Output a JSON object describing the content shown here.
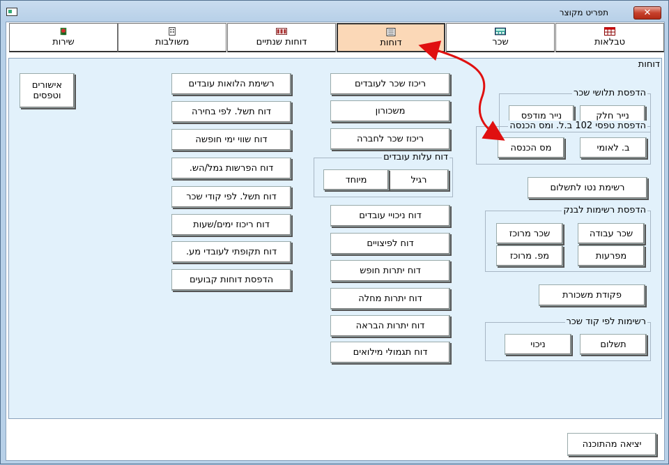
{
  "window": {
    "title": "תפריט מקוצר",
    "close_label": "✕"
  },
  "tabs": [
    {
      "label": "טבלאות",
      "icon": "table-icon"
    },
    {
      "label": "שכר",
      "icon": "calculator-icon"
    },
    {
      "label": "דוחות",
      "icon": "report-icon"
    },
    {
      "label": "דוחות שנתיים",
      "icon": "annual-report-icon"
    },
    {
      "label": "משולבות",
      "icon": "building-icon"
    },
    {
      "label": "שירות",
      "icon": "service-icon"
    }
  ],
  "panel": {
    "title": "דוחות",
    "groups": {
      "payslip_print": {
        "legend": "הדפסת תלושי שכר",
        "buttons": [
          "נייר חלק",
          "נייר מודפס"
        ]
      },
      "form_102_print": {
        "legend": "הדפסת טפסי 102 ב.ל. ומס הכנסה",
        "buttons": [
          "ב. לאומי",
          "מס הכנסה"
        ]
      },
      "employee_costs": {
        "legend": "דוח עלות עובדים",
        "buttons": [
          "רגיל",
          "מיוחד"
        ]
      },
      "bank_lists_print": {
        "legend": "הדפסת רשימות לבנק",
        "buttons": [
          "שכר עבודה",
          "שכר מרוכז",
          "מפרעות",
          "מפ. מרוכז"
        ]
      },
      "lists_by_wage_code": {
        "legend": "רשימות לפי קוד שכר",
        "buttons": [
          "תשלום",
          "ניכוי"
        ]
      }
    },
    "net_pay_list": "רשימת נטו לתשלום",
    "payroll_order": "פקודת משכורת",
    "middle_column": [
      "ריכוז שכר לעובדים",
      "משכורון",
      "ריכוז שכר לחברה",
      "דוח ניכויי עובדים",
      "דוח לפיצויים",
      "דוח יתרות חופש",
      "דוח יתרות מחלה",
      "דוח יתרות הבראה",
      "דוח תגמולי מילואים"
    ],
    "left_column": [
      "רשימת הלואות עובדים",
      "דוח תשל. לפי בחירה",
      "דוח שווי ימי חופשה",
      "דוח הפרשות גמל/הש.",
      "דוח תשל. לפי קודי שכר",
      "דוח ריכוז ימים/שעות",
      "דוח תקופתי לעובדי מע.",
      "הדפסת דוחות קבועים"
    ],
    "approvals_line1": "אישורים",
    "approvals_line2": "וטפסים"
  },
  "exit_button": "יציאה מהתוכנה",
  "colors": {
    "active_tab": "#fbd8b7",
    "panel_bg": "#e2f1fb",
    "arrow": "#e01010",
    "window_frame": "#b7d0e8"
  }
}
